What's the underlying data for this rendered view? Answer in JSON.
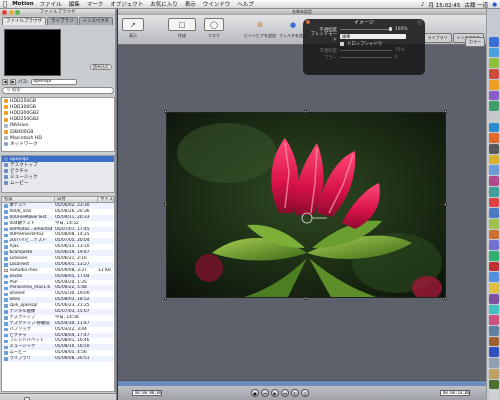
{
  "menubar": {
    "apple_icon": "apple-logo-icon",
    "app_name": "Motion",
    "items": [
      "ファイル",
      "編集",
      "マーク",
      "オブジェクト",
      "お気に入り",
      "表示",
      "ウインドウ",
      "ヘルプ"
    ],
    "clock": "月 15:02:45",
    "user": "古舘 一道"
  },
  "browser": {
    "title": "ファイルブラウザ",
    "tabs": [
      "ファイルブラウザ",
      "ライブラリ",
      "インスペクタ"
    ],
    "import_label": "読み込む",
    "path_label": "パス:",
    "path_value": "openspr",
    "search_placeholder": "検索",
    "devices": [
      {
        "label": "HDD250GB",
        "type": "disk"
      },
      {
        "label": "HDD300GB",
        "type": "disk"
      },
      {
        "label": "HDD300GB2",
        "type": "disk"
      },
      {
        "label": "HDD250GB2",
        "type": "disk"
      },
      {
        "label": "INVision",
        "type": "hd"
      },
      {
        "label": "iDB400GB",
        "type": "disk"
      },
      {
        "label": "Macintosh HD",
        "type": "hd"
      },
      {
        "label": "ネットワーク",
        "type": "net"
      }
    ],
    "places": [
      {
        "label": "openspr",
        "selected": true
      },
      {
        "label": "デスクトップ",
        "selected": false
      },
      {
        "label": "ピクチャ",
        "selected": false
      },
      {
        "label": "ミュージック",
        "selected": false
      },
      {
        "label": "ムービー",
        "selected": false
      }
    ],
    "columns": [
      "名前",
      "日付",
      "サイズ"
    ],
    "files": [
      {
        "name": "本テスト",
        "date": "05/06/02, 23:30",
        "size": ""
      },
      {
        "name": "0000_icon",
        "date": "05/06/26, 20:36",
        "size": ""
      },
      {
        "name": "000FileMakerTest",
        "date": "05/04/11, 20:33",
        "size": ""
      },
      {
        "name": "004錦テスト",
        "date": "今日, 14:52",
        "size": ""
      },
      {
        "name": "00Photos…ements4",
        "date": "05/07/07, 17:45",
        "size": ""
      },
      {
        "name": "00PremierePro2",
        "date": "05/08/08, 14:25",
        "size": ""
      },
      {
        "name": "20/ハイビ…テスト",
        "date": "05/07/05, 20:04",
        "size": ""
      },
      {
        "name": "Ajax",
        "date": "05/06/15, 13:10",
        "size": ""
      },
      {
        "name": "bcomplete",
        "date": "05/06/19, 19:47",
        "size": ""
      },
      {
        "name": "Limesen",
        "date": "05/06/21, 2:16",
        "size": ""
      },
      {
        "name": "LocalTest",
        "date": "05/06/01, 13:27",
        "size": ""
      },
      {
        "name": "noAudio.mov",
        "date": "04/09/08, 3:37",
        "size": "12 KB",
        "file": true
      },
      {
        "name": "osxdo",
        "date": "05/08/05, 17:04",
        "size": ""
      },
      {
        "name": "PSP",
        "date": "05/04/20, 1:35",
        "size": ""
      },
      {
        "name": "rhinoceros_mac1.6",
        "date": "05/06/22, 5:48",
        "size": ""
      },
      {
        "name": "Shared",
        "date": "05/05/30, 19:00",
        "size": ""
      },
      {
        "name": "Sites",
        "date": "05/08/03, 18:52",
        "size": ""
      },
      {
        "name": "spin_openspr",
        "date": "05/06/23, 21:25",
        "size": ""
      },
      {
        "name": "デジタル画像",
        "date": "05/07/03, 15:07",
        "size": ""
      },
      {
        "name": "デスクトップ",
        "date": "今日, 14:58",
        "size": ""
      },
      {
        "name": "デスクトップ-移動前",
        "date": "05/04/30, 11:47",
        "size": ""
      },
      {
        "name": "パブリック",
        "date": "05/03/22, 3:44",
        "size": ""
      },
      {
        "name": "ピクチャ",
        "date": "05/08/04, 17:47",
        "size": ""
      },
      {
        "name": "フレンドパペット",
        "date": "05/08/01, 16:46",
        "size": ""
      },
      {
        "name": "ミュージック",
        "date": "05/08/10, 16:50",
        "size": ""
      },
      {
        "name": "ムービー",
        "date": "05/08/05, 4:56",
        "size": ""
      },
      {
        "name": "ライブラリ",
        "date": "05/08/08, 20:51",
        "size": ""
      }
    ]
  },
  "canvas": {
    "title": "名称未設定",
    "toolbar": [
      {
        "label": "表示",
        "icon": "arrow-tools-icon"
      },
      {
        "label": "作成",
        "icon": "shape-tools-icon"
      },
      {
        "label": "マスク",
        "icon": "mask-tools-icon"
      },
      {
        "label": "ビヘイビアを追加",
        "icon": "behavior-icon"
      },
      {
        "label": "フィルタを追加",
        "icon": "filter-icon"
      }
    ],
    "right_buttons": [
      "ライブラリ",
      "インスペクタ"
    ],
    "zoom_value": "カラー",
    "timecode_start": "00:00:00;00",
    "timecode_end": "00:00:10;00"
  },
  "hud": {
    "title": "イメージ",
    "opacity_label": "不透明度",
    "opacity_value": "100%",
    "blend_label": "ブレンドモード",
    "blend_value": "標準",
    "drop_shadow_label": "ドロップシャドウ",
    "shadow_opacity_label": "不透明度",
    "shadow_opacity_value": "75%",
    "blur_label": "ブラー",
    "blur_value": "0"
  },
  "dock": {
    "colors": [
      "#3a6fd8",
      "#4aa0e0",
      "#8fbf3c",
      "#d04b3a",
      "#f0a020",
      "#8a5cc8",
      "#3f9e6a",
      "#c8c8c8",
      "#2a8ad0",
      "#e06a2a",
      "#5a5a5a",
      "#d8b030",
      "#6a9ad8",
      "#b04a8a",
      "#40a0a0",
      "#e04040",
      "#4a7ac0",
      "#a0c050",
      "#d07030",
      "#7070d0",
      "#30b070",
      "#c03030",
      "#5090e0",
      "#e0c040",
      "#8050a0",
      "#40c0c0",
      "#d05080",
      "#6080a0",
      "#a06030",
      "#3050c0",
      "#90a0b0",
      "#c0a060",
      "#507030",
      "#d0d0d0"
    ]
  }
}
